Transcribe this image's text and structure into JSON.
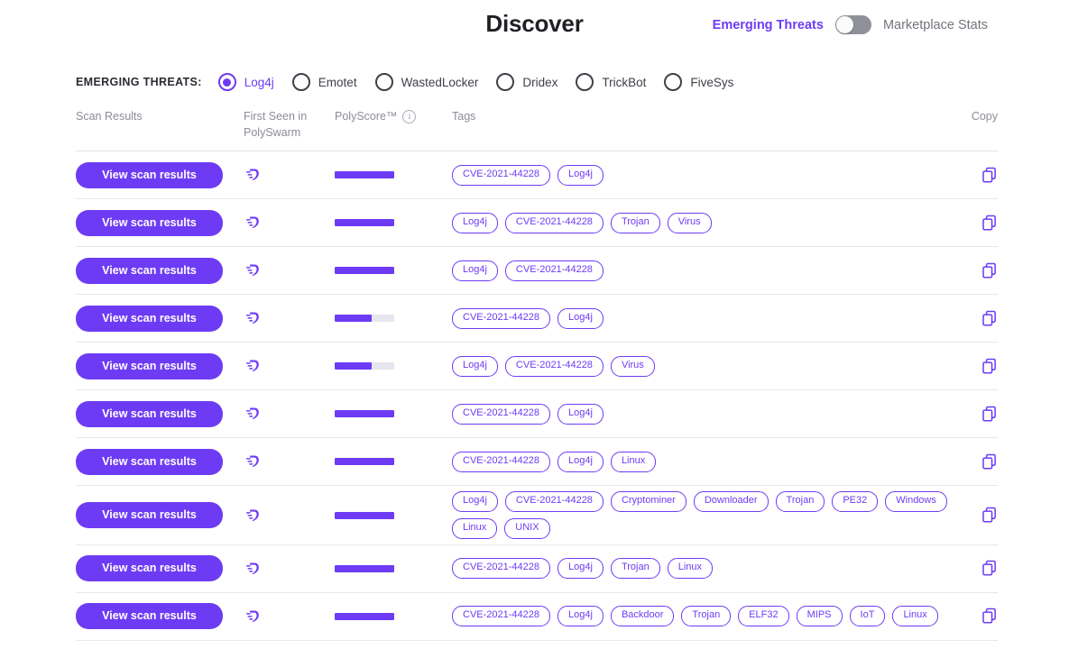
{
  "header": {
    "title": "Discover",
    "toggle": {
      "left_label": "Emerging Threats",
      "right_label": "Marketplace Stats",
      "state": "off"
    }
  },
  "filters": {
    "label": "EMERGING THREATS:",
    "selected": "Log4j",
    "options": [
      {
        "label": "Log4j",
        "selected": true
      },
      {
        "label": "Emotet",
        "selected": false
      },
      {
        "label": "WastedLocker",
        "selected": false
      },
      {
        "label": "Dridex",
        "selected": false
      },
      {
        "label": "TrickBot",
        "selected": false
      },
      {
        "label": "FiveSys",
        "selected": false
      }
    ]
  },
  "table": {
    "columns": [
      {
        "key": "scan",
        "label": "Scan Results"
      },
      {
        "key": "seen",
        "label": "First Seen in PolySwarm"
      },
      {
        "key": "score",
        "label": "PolyScore™",
        "icon": "info-icon"
      },
      {
        "key": "tags",
        "label": "Tags"
      },
      {
        "key": "copy",
        "label": "Copy"
      }
    ],
    "row_button_label": "View scan results",
    "seen_icon": "polyswarm-logo-icon",
    "copy_icon": "copy-icon",
    "rows": [
      {
        "score": 100,
        "tags": [
          "CVE-2021-44228",
          "Log4j"
        ]
      },
      {
        "score": 100,
        "tags": [
          "Log4j",
          "CVE-2021-44228",
          "Trojan",
          "Virus"
        ]
      },
      {
        "score": 100,
        "tags": [
          "Log4j",
          "CVE-2021-44228"
        ]
      },
      {
        "score": 62,
        "tags": [
          "CVE-2021-44228",
          "Log4j"
        ]
      },
      {
        "score": 62,
        "tags": [
          "Log4j",
          "CVE-2021-44228",
          "Virus"
        ]
      },
      {
        "score": 100,
        "tags": [
          "CVE-2021-44228",
          "Log4j"
        ]
      },
      {
        "score": 100,
        "tags": [
          "CVE-2021-44228",
          "Log4j",
          "Linux"
        ]
      },
      {
        "score": 100,
        "tags": [
          "Log4j",
          "CVE-2021-44228",
          "Cryptominer",
          "Downloader",
          "Trojan",
          "PE32",
          "Windows",
          "Linux",
          "UNIX"
        ]
      },
      {
        "score": 100,
        "tags": [
          "CVE-2021-44228",
          "Log4j",
          "Trojan",
          "Linux"
        ]
      },
      {
        "score": 100,
        "tags": [
          "CVE-2021-44228",
          "Log4j",
          "Backdoor",
          "Trojan",
          "ELF32",
          "MIPS",
          "IoT",
          "Linux"
        ]
      }
    ]
  },
  "colors": {
    "accent": "#6E3BF5",
    "track": "#e5e6ee",
    "border": "#e6e7ee",
    "muted_text": "#8b8d99",
    "toggle_track": "#8f9199"
  }
}
